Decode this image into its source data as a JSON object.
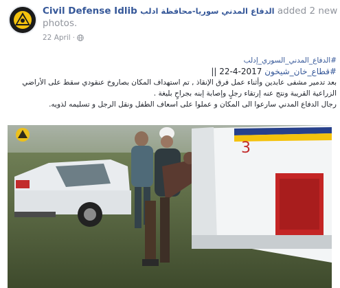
{
  "post": {
    "page_name": "Civil Defense Idlib",
    "page_name_arabic": "الدفاع المدني سوريا-محافظة ادلب",
    "action_text": "added 2 new photos.",
    "date": "22 April"
  },
  "content": {
    "hashtag_1": "#الدفاع_المدني_السوري_إدلب",
    "hashtag_2": "#قطاع_خان_شيخون",
    "date_separator": "|| 22-4-2017",
    "line_1": "بعد تدمير مشفى عابدين وأثناء عمل فرق الإنقاذ , تم استهداف المكان بصاروخ عنقودي سقط على الأراضي",
    "line_2": "الزراعية القريبة ونتج عنه إرتقاء رجلٍ وإصابة إبنه بجراحٍ بليغة .",
    "line_3": "رجال الدفاع المدني سارعوا الى المكان و عملوا على اسعاف الطفل ونقل الرجل و تسليمه لذويه."
  },
  "photo": {
    "vehicle_marking": "3"
  },
  "colors": {
    "link": "#365899",
    "meta": "#90949c",
    "text": "#1d2129"
  }
}
